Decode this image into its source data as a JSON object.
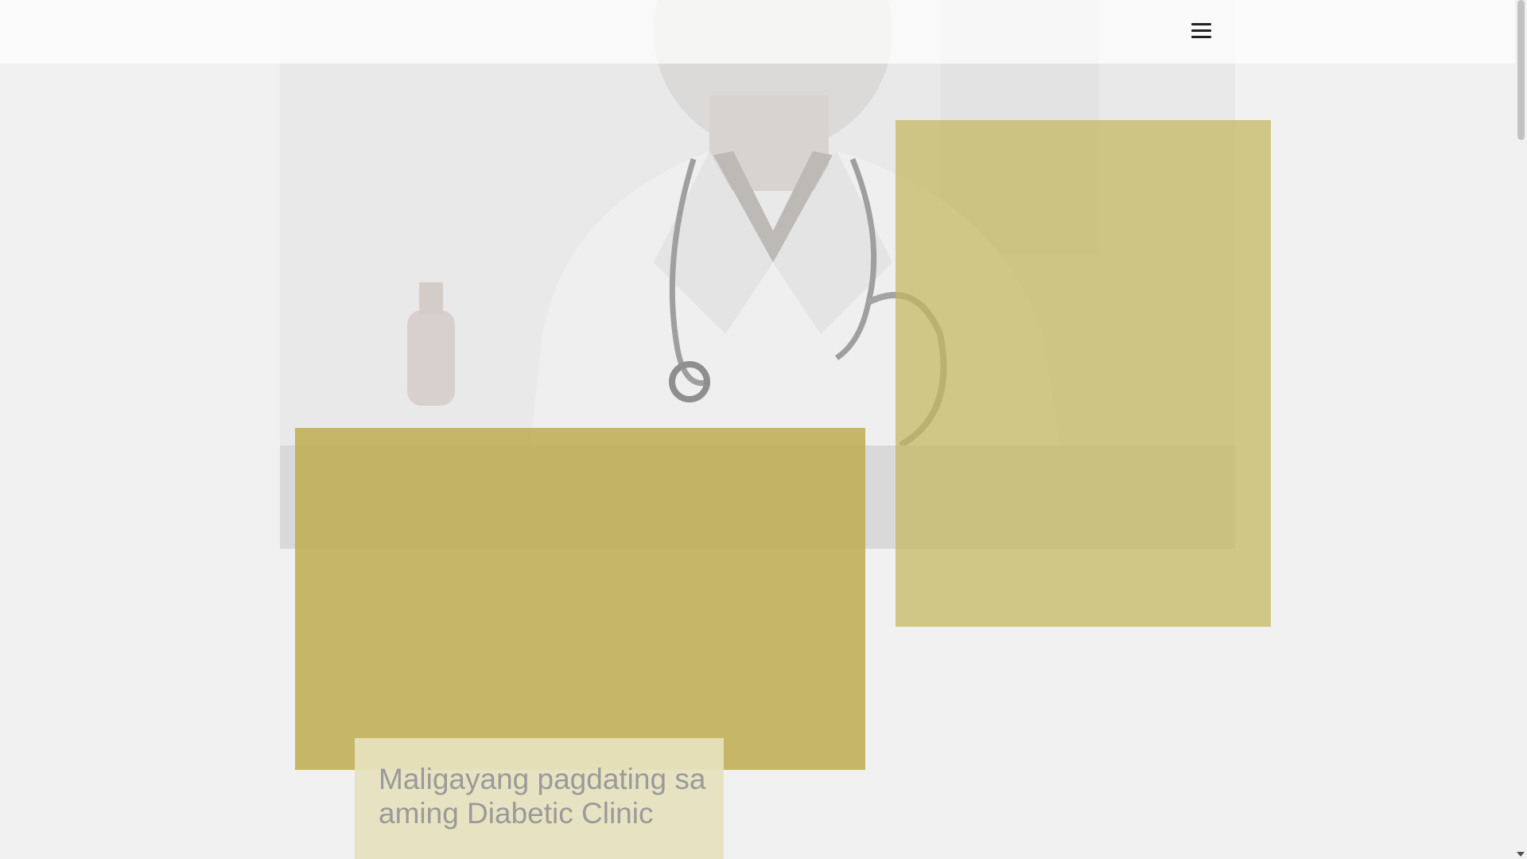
{
  "header": {
    "menu_icon": "hamburger-menu-icon"
  },
  "hero": {
    "image_subject": "doctor with stethoscope",
    "accent_color": "#c4b65c",
    "welcome_title": "Maligayang pagdating sa aming Diabetic Clinic"
  },
  "scrollbar": {
    "down_icon": "scroll-down-arrow-icon"
  }
}
